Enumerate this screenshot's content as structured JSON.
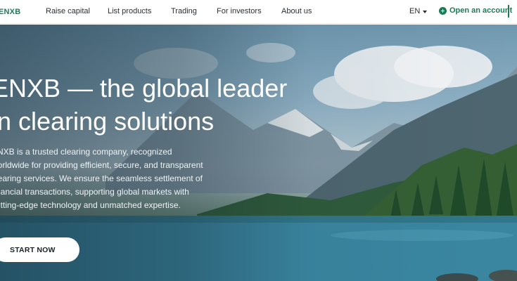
{
  "nav": {
    "logo": "ENXB",
    "items": [
      {
        "label": "Raise capital"
      },
      {
        "label": "List products"
      },
      {
        "label": "Trading"
      },
      {
        "label": "For investors"
      },
      {
        "label": "About us"
      }
    ],
    "language": "EN",
    "open_account": "Open an account"
  },
  "hero": {
    "headline_lines": [
      "ENXB — the global leader",
      "in clearing solutions"
    ],
    "lead_lines": [
      "ENXB is a trusted clearing company, recognized",
      "worldwide for providing efficient, secure, and transparent",
      "clearing services. We ensure the seamless settlement of",
      "financial transactions, supporting global markets with",
      "cutting-edge technology and unmatched expertise."
    ],
    "cta_label": "START NOW"
  },
  "colors": {
    "brand_green": "#1d7a54",
    "text_dark": "#2a2f33"
  },
  "icons": [
    "plus-circle-icon",
    "chevron-down-icon"
  ]
}
